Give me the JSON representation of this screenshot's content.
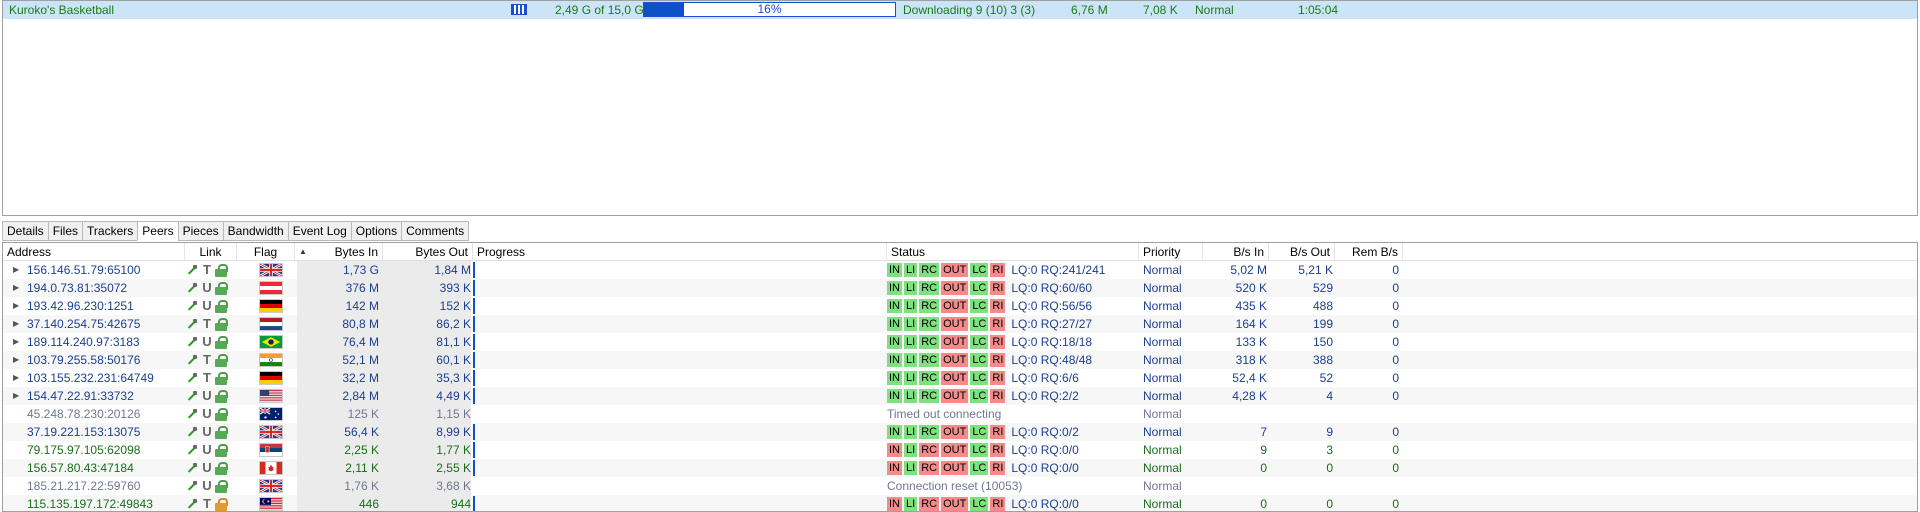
{
  "torrent": {
    "name": "Kuroko's Basketball",
    "size": "2,49 G of 15,0 G",
    "progress_percent": 16,
    "progress_label": "16%",
    "status": "Downloading 9 (10) 3 (3)",
    "down_speed": "6,76 M",
    "up_speed": "7,08 K",
    "priority": "Normal",
    "eta": "1:05:04"
  },
  "tabs": [
    "Details",
    "Files",
    "Trackers",
    "Peers",
    "Pieces",
    "Bandwidth",
    "Event Log",
    "Options",
    "Comments"
  ],
  "active_tab": "Peers",
  "peer_columns": {
    "address": "Address",
    "link": "Link",
    "flag": "Flag",
    "bytes_in": "Bytes In",
    "bytes_out": "Bytes Out",
    "progress": "Progress",
    "status": "Status",
    "priority": "Priority",
    "bs_in": "B/s In",
    "bs_out": "B/s Out",
    "rem_bs": "Rem B/s"
  },
  "status_flags": [
    "IN",
    "LI",
    "RC",
    "OUT",
    "LC",
    "RI"
  ],
  "colors": {
    "selection": "#cce4f7",
    "progress_blue": "#0d50c8",
    "flag_green": "#7ee07e",
    "flag_red": "#f58a8a"
  },
  "peers": [
    {
      "address": "156.146.51.79:65100",
      "flag": "gb",
      "lock": "green",
      "bytes_in": "1,73 G",
      "bytes_out": "1,84 M",
      "progress": 1.0,
      "notches": [],
      "kind": "active",
      "lq": "LQ:0 RQ:241/241",
      "priority": "Normal",
      "bs_in": "5,02 M",
      "bs_out": "5,21 K",
      "rem": "0",
      "expandable": true,
      "text_color": "blue"
    },
    {
      "address": "194.0.73.81:35072",
      "flag": "at",
      "lock": "green",
      "bytes_in": "376 M",
      "bytes_out": "393 K",
      "progress": 1.0,
      "notches": [
        [
          0.0,
          0.3,
          0.055,
          0.7
        ],
        [
          0.91,
          0.3,
          0.04,
          0.7
        ],
        [
          0.955,
          0.3,
          0.045,
          0.2
        ]
      ],
      "kind": "active",
      "lq": "LQ:0 RQ:60/60",
      "priority": "Normal",
      "bs_in": "520 K",
      "bs_out": "529",
      "rem": "0",
      "expandable": true,
      "text_color": "blue"
    },
    {
      "address": "193.42.96.230:1251",
      "flag": "de",
      "lock": "green",
      "bytes_in": "142 M",
      "bytes_out": "152 K",
      "progress": 1.0,
      "notches": [],
      "kind": "active",
      "lq": "LQ:0 RQ:56/56",
      "priority": "Normal",
      "bs_in": "435 K",
      "bs_out": "488",
      "rem": "0",
      "expandable": true,
      "text_color": "blue"
    },
    {
      "address": "37.140.254.75:42675",
      "flag": "nl",
      "lock": "green",
      "bytes_in": "80,8 M",
      "bytes_out": "86,2 K",
      "progress": 1.0,
      "notches": [],
      "kind": "active",
      "lq": "LQ:0 RQ:27/27",
      "priority": "Normal",
      "bs_in": "164 K",
      "bs_out": "199",
      "rem": "0",
      "expandable": true,
      "text_color": "blue"
    },
    {
      "address": "189.114.240.97:3183",
      "flag": "br",
      "lock": "green",
      "bytes_in": "76,4 M",
      "bytes_out": "81,1 K",
      "progress": 1.0,
      "notches": [
        [
          0.05,
          0.3,
          0.9,
          0.35
        ]
      ],
      "kind": "active",
      "lq": "LQ:0 RQ:18/18",
      "priority": "Normal",
      "bs_in": "133 K",
      "bs_out": "150",
      "rem": "0",
      "expandable": true,
      "text_color": "blue"
    },
    {
      "address": "103.79.255.58:50176",
      "flag": "in",
      "lock": "green",
      "bytes_in": "52,1 M",
      "bytes_out": "60,1 K",
      "progress": 1.0,
      "notches": [
        [
          0.0,
          0.4,
          0.85,
          0.6
        ],
        [
          0.88,
          0.4,
          0.07,
          0.6
        ]
      ],
      "kind": "active",
      "lq": "LQ:0 RQ:48/48",
      "priority": "Normal",
      "bs_in": "318 K",
      "bs_out": "388",
      "rem": "0",
      "expandable": true,
      "text_color": "blue"
    },
    {
      "address": "103.155.232.231:64749",
      "flag": "de",
      "lock": "green",
      "bytes_in": "32,2 M",
      "bytes_out": "35,3 K",
      "progress": 1.0,
      "notches": [],
      "kind": "active",
      "lq": "LQ:0 RQ:6/6",
      "priority": "Normal",
      "bs_in": "52,4 K",
      "bs_out": "52",
      "rem": "0",
      "expandable": true,
      "text_color": "blue"
    },
    {
      "address": "154.47.22.91:33732",
      "flag": "us",
      "lock": "green",
      "bytes_in": "2,84 M",
      "bytes_out": "4,49 K",
      "progress": 1.0,
      "notches": [],
      "kind": "active",
      "lq": "LQ:0 RQ:2/2",
      "priority": "Normal",
      "bs_in": "4,28 K",
      "bs_out": "4",
      "rem": "0",
      "expandable": true,
      "text_color": "blue"
    },
    {
      "address": "45.248.78.230:20126",
      "flag": "au",
      "lock": "green",
      "bytes_in": "125 K",
      "bytes_out": "1,15 K",
      "progress": 0,
      "notches": [],
      "kind": "message",
      "message": "Timed out connecting",
      "priority": "Normal",
      "bs_in": "",
      "bs_out": "",
      "rem": "",
      "expandable": false,
      "text_color": "gray"
    },
    {
      "address": "37.19.221.153:13075",
      "flag": "gb",
      "lock": "green",
      "bytes_in": "56,4 K",
      "bytes_out": "8,99 K",
      "progress": 1.0,
      "notches": [],
      "kind": "active",
      "lq": "LQ:0 RQ:0/2",
      "priority": "Normal",
      "bs_in": "7",
      "bs_out": "9",
      "rem": "0",
      "expandable": false,
      "text_color": "blue"
    },
    {
      "address": "79.175.97.105:62098",
      "flag": "rs",
      "lock": "green",
      "bytes_in": "2,25 K",
      "bytes_out": "1,77 K",
      "progress": 0.02,
      "notches": [],
      "kind": "active",
      "lq": "LQ:0 RQ:0/0",
      "priority": "Normal",
      "bs_in": "9",
      "bs_out": "3",
      "rem": "0",
      "expandable": false,
      "text_color": "green"
    },
    {
      "address": "156.57.80.43:47184",
      "flag": "ca",
      "lock": "green",
      "bytes_in": "2,11 K",
      "bytes_out": "2,55 K",
      "progress": 0.02,
      "notches": [],
      "kind": "active",
      "lq": "LQ:0 RQ:0/0",
      "priority": "Normal",
      "bs_in": "0",
      "bs_out": "0",
      "rem": "0",
      "expandable": false,
      "text_color": "green"
    },
    {
      "address": "185.21.217.22:59760",
      "flag": "gb",
      "lock": "green",
      "bytes_in": "1,76 K",
      "bytes_out": "3,68 K",
      "progress": 0,
      "notches": [],
      "kind": "message",
      "message": "Connection reset (10053)",
      "priority": "Normal",
      "bs_in": "",
      "bs_out": "",
      "rem": "",
      "expandable": false,
      "text_color": "gray"
    },
    {
      "address": "115.135.197.172:49843",
      "flag": "my",
      "lock": "orange",
      "bytes_in": "446",
      "bytes_out": "944",
      "progress": 0.02,
      "notches": [],
      "kind": "active",
      "lq": "LQ:0 RQ:0/0",
      "priority": "Normal",
      "bs_in": "0",
      "bs_out": "0",
      "rem": "0",
      "expandable": false,
      "text_color": "green"
    }
  ]
}
